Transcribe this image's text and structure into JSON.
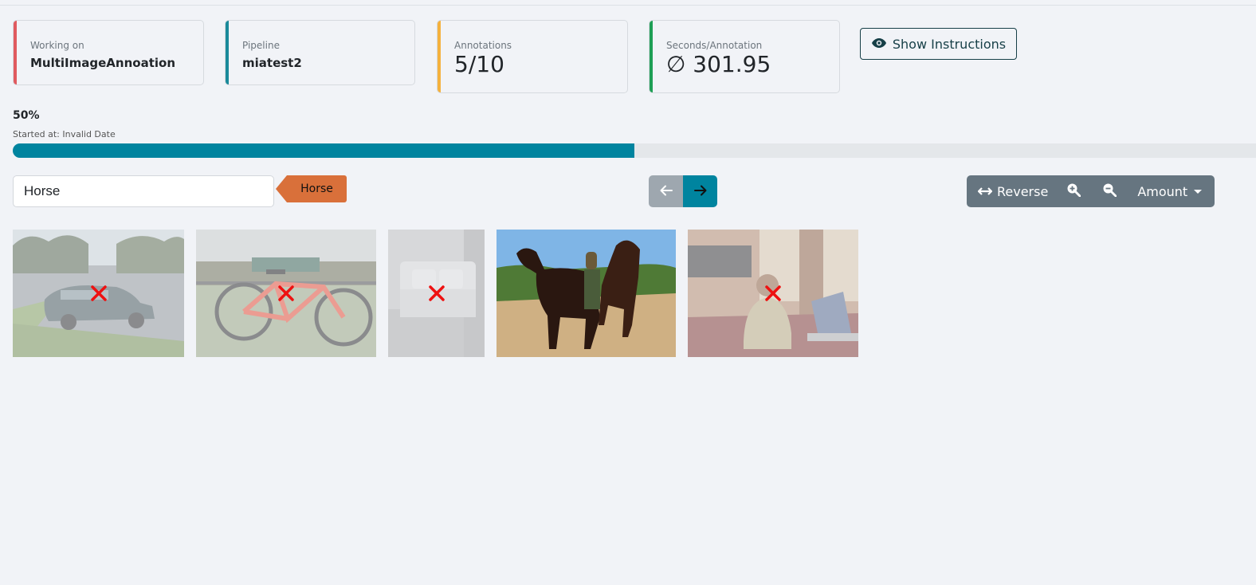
{
  "stats": [
    {
      "label": "Working on",
      "value": "MultiImageAnnoation",
      "accent": "#e05a5f"
    },
    {
      "label": "Pipeline",
      "value": "miatest2",
      "accent": "#1a8a9a"
    },
    {
      "label": "Annotations",
      "value": "5/10",
      "accent": "#f5b13d"
    },
    {
      "label": "Seconds/Annotation",
      "value": "∅ 301.95",
      "accent": "#1e9e55"
    }
  ],
  "instructions_button": {
    "label": "Show Instructions",
    "icon": "eye-icon"
  },
  "progress": {
    "percent_label": "50%",
    "fraction": 0.5,
    "started": "Started at: Invalid Date",
    "color": "#00849f"
  },
  "label_input": {
    "value": "Horse"
  },
  "label_tag": {
    "text": "Horse",
    "color": "#d9703a"
  },
  "navigation": {
    "prev_icon": "arrow-left-icon",
    "next_icon": "arrow-right-icon"
  },
  "toolbar": {
    "reverse_label": "Reverse",
    "zoom_in_icon": "zoom-in-icon",
    "zoom_out_icon": "zoom-out-icon",
    "amount_label": "Amount"
  },
  "images": [
    {
      "subject": "car",
      "rejected": true
    },
    {
      "subject": "bicycle",
      "rejected": true
    },
    {
      "subject": "sofa",
      "rejected": true
    },
    {
      "subject": "horses",
      "rejected": false
    },
    {
      "subject": "person-with-laptop",
      "rejected": true
    }
  ]
}
